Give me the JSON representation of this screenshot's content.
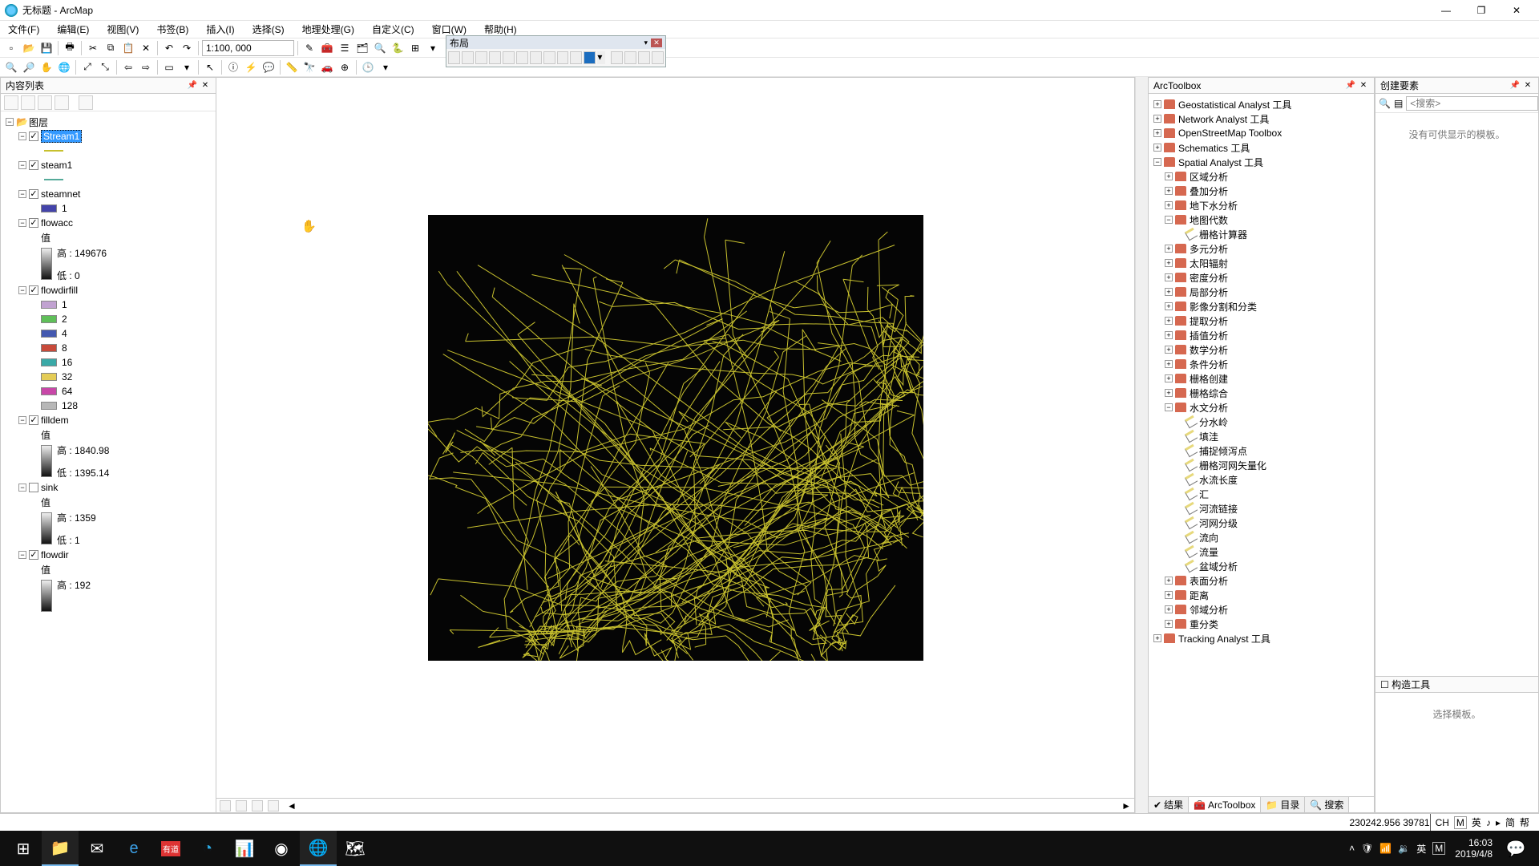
{
  "window": {
    "title": "无标题 - ArcMap"
  },
  "menu": [
    "文件(F)",
    "编辑(E)",
    "视图(V)",
    "书签(B)",
    "插入(I)",
    "选择(S)",
    "地理处理(G)",
    "自定义(C)",
    "窗口(W)",
    "帮助(H)"
  ],
  "scale": "1:100, 000",
  "layout_toolbar_title": "布局",
  "panels": {
    "toc": "内容列表",
    "toolbox": "ArcToolbox",
    "create": "创建要素",
    "construct": "构造工具"
  },
  "toc": {
    "root": "图层",
    "layers": [
      {
        "name": "Stream1",
        "checked": true,
        "selected": true,
        "type": "line",
        "swatch": "#c7c02e"
      },
      {
        "name": "steam1",
        "checked": true,
        "type": "line",
        "swatch": "#55aa99"
      },
      {
        "name": "steamnet",
        "checked": true,
        "type": "cat",
        "classes": [
          {
            "label": "1",
            "color": "#4444aa"
          }
        ]
      },
      {
        "name": "flowacc",
        "checked": true,
        "type": "stretch",
        "value_label": "值",
        "high": "高 : 149676",
        "low": "低 : 0"
      },
      {
        "name": "flowdirfill",
        "checked": true,
        "type": "cat",
        "classes": [
          {
            "label": "1",
            "color": "#c1a2d1"
          },
          {
            "label": "2",
            "color": "#5fbf59"
          },
          {
            "label": "4",
            "color": "#4459b0"
          },
          {
            "label": "8",
            "color": "#c84a3a"
          },
          {
            "label": "16",
            "color": "#3aa9a7"
          },
          {
            "label": "32",
            "color": "#e4cc56"
          },
          {
            "label": "64",
            "color": "#c847a8"
          },
          {
            "label": "128",
            "color": "#b7b7b7"
          }
        ]
      },
      {
        "name": "filldem",
        "checked": true,
        "type": "stretch",
        "value_label": "值",
        "high": "高 : 1840.98",
        "low": "低 : 1395.14"
      },
      {
        "name": "sink",
        "checked": false,
        "type": "stretch",
        "value_label": "值",
        "high": "高 : 1359",
        "low": "低 : 1"
      },
      {
        "name": "flowdir",
        "checked": true,
        "type": "stretch",
        "value_label": "值",
        "high": "高 : 192",
        "low": ""
      }
    ]
  },
  "toolbox": {
    "roots": [
      "Geostatistical Analyst 工具",
      "Network Analyst 工具",
      "OpenStreetMap Toolbox",
      "Schematics 工具"
    ],
    "spatial": {
      "label": "Spatial Analyst 工具",
      "groups1": [
        "区域分析",
        "叠加分析",
        "地下水分析"
      ],
      "map_algebra": {
        "label": "地图代数",
        "tool": "栅格计算器"
      },
      "groups2": [
        "多元分析",
        "太阳辐射",
        "密度分析",
        "局部分析",
        "影像分割和分类",
        "提取分析",
        "插值分析",
        "数学分析",
        "条件分析",
        "栅格创建",
        "栅格综合"
      ],
      "hydrology": {
        "label": "水文分析",
        "tools": [
          "分水岭",
          "填洼",
          "捕捉倾泻点",
          "栅格河网矢量化",
          "水流长度",
          "汇",
          "河流链接",
          "河网分级",
          "流向",
          "流量",
          "盆域分析"
        ]
      },
      "groups3": [
        "表面分析",
        "距离",
        "邻域分析",
        "重分类"
      ]
    },
    "tracking": "Tracking Analyst 工具",
    "tabs": [
      "结果",
      "ArcToolbox",
      "目录",
      "搜索"
    ]
  },
  "create": {
    "search_placeholder": "<搜索>",
    "empty": "没有可供显示的模板。",
    "select_template": "选择模板。"
  },
  "status": {
    "coords": "230242.956  39781",
    "ime": [
      "CH",
      "M",
      "英",
      "♪",
      "▸",
      "简",
      "帮"
    ]
  },
  "clock": {
    "time": "16:03",
    "date": "2019/4/8"
  }
}
